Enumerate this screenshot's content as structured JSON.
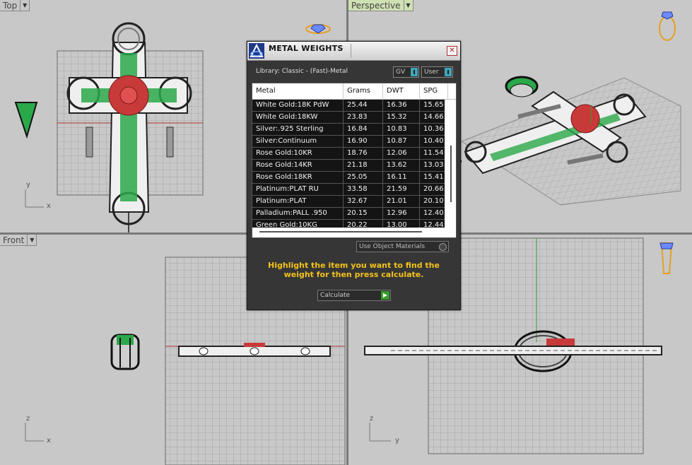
{
  "viewports": {
    "top": {
      "label": "Top",
      "axis_x": "x",
      "axis_y": "y"
    },
    "perspective": {
      "label": "Perspective"
    },
    "front": {
      "label": "Front",
      "axis_x": "x",
      "axis_y": "z"
    },
    "right": {
      "axis_x": "y",
      "axis_y": "z"
    }
  },
  "dialog": {
    "title": "METAL WEIGHTS",
    "close_glyph": "✕",
    "library_label": "Library: Classic - (Fast)-Metal",
    "toggle_gv": "GV",
    "toggle_user": "User",
    "columns": [
      "Metal",
      "Grams",
      "DWT",
      "SPG"
    ],
    "rows": [
      {
        "metal": "White Gold:18K PdW",
        "grams": "25.44",
        "dwt": "16.36",
        "spg": "15.65"
      },
      {
        "metal": "White Gold:18KW",
        "grams": "23.83",
        "dwt": "15.32",
        "spg": "14.66"
      },
      {
        "metal": "Silver:.925 Sterling",
        "grams": "16.84",
        "dwt": "10.83",
        "spg": "10.36"
      },
      {
        "metal": "Silver:Continuum",
        "grams": "16.90",
        "dwt": "10.87",
        "spg": "10.40"
      },
      {
        "metal": "Rose Gold:10KR",
        "grams": "18.76",
        "dwt": "12.06",
        "spg": "11.54"
      },
      {
        "metal": "Rose Gold:14KR",
        "grams": "21.18",
        "dwt": "13.62",
        "spg": "13.03"
      },
      {
        "metal": "Rose Gold:18KR",
        "grams": "25.05",
        "dwt": "16.11",
        "spg": "15.41"
      },
      {
        "metal": "Platinum:PLAT RU",
        "grams": "33.58",
        "dwt": "21.59",
        "spg": "20.66"
      },
      {
        "metal": "Platinum:PLAT",
        "grams": "32.67",
        "dwt": "21.01",
        "spg": "20.10"
      },
      {
        "metal": "Palladium:PALL .950",
        "grams": "20.15",
        "dwt": "12.96",
        "spg": "12.40"
      },
      {
        "metal": "Green Gold:10KG",
        "grams": "20.22",
        "dwt": "13.00",
        "spg": "12.44"
      }
    ],
    "use_object_materials": "Use Object Materials",
    "hint": "Highlight the item you want to find the weight for then press calculate.",
    "calculate_label": "Calculate",
    "calculate_glyph": "▶"
  },
  "colors": {
    "viewport_bg": "#c8c8c8",
    "grid": "#8a8a8a",
    "gem_green": "#2aa84a",
    "gem_red": "#c83a3a",
    "dialog_bg": "#363636",
    "hint_text": "#f2c21b",
    "active_label": "#cfe0b2"
  }
}
